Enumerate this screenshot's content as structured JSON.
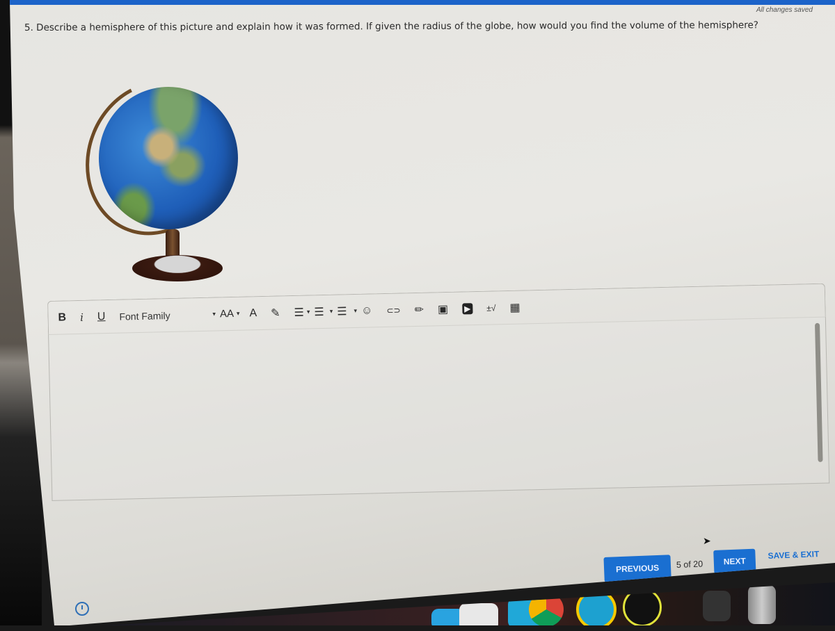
{
  "page": {
    "status": "All changes saved",
    "question": "5. Describe a hemisphere of this picture and explain how it was formed. If given the radius of the globe, how would you find the volume of the hemisphere?",
    "image_alt": "Desk globe on a wooden stand"
  },
  "toolbar": {
    "bold": "B",
    "italic": "i",
    "underline": "U",
    "font_family": "Font Family",
    "font_size_caret": "▾",
    "font_size": "AA",
    "items": [
      {
        "name": "font-color-icon",
        "glyph": "A"
      },
      {
        "name": "highlight-icon",
        "glyph": "✎"
      },
      {
        "name": "align-icon",
        "glyph": "☰"
      },
      {
        "name": "numbered-list-icon",
        "glyph": "☰"
      },
      {
        "name": "bullet-list-icon",
        "glyph": "☰"
      },
      {
        "name": "emoji-icon",
        "glyph": "☺"
      },
      {
        "name": "link-icon",
        "glyph": "⊂⊃"
      },
      {
        "name": "pencil-icon",
        "glyph": "✏"
      },
      {
        "name": "image-icon",
        "glyph": "▣"
      },
      {
        "name": "video-icon",
        "glyph": "▶"
      },
      {
        "name": "math-icon",
        "glyph": "±√"
      },
      {
        "name": "table-icon",
        "glyph": "▦"
      }
    ]
  },
  "editor": {
    "value": ""
  },
  "navigation": {
    "previous": "PREVIOUS",
    "page_count": "5 of 20",
    "next": "NEXT",
    "save_exit": "SAVE & EXIT"
  },
  "colors": {
    "accent": "#1a6fd1",
    "top_bar": "#1c63c9"
  }
}
